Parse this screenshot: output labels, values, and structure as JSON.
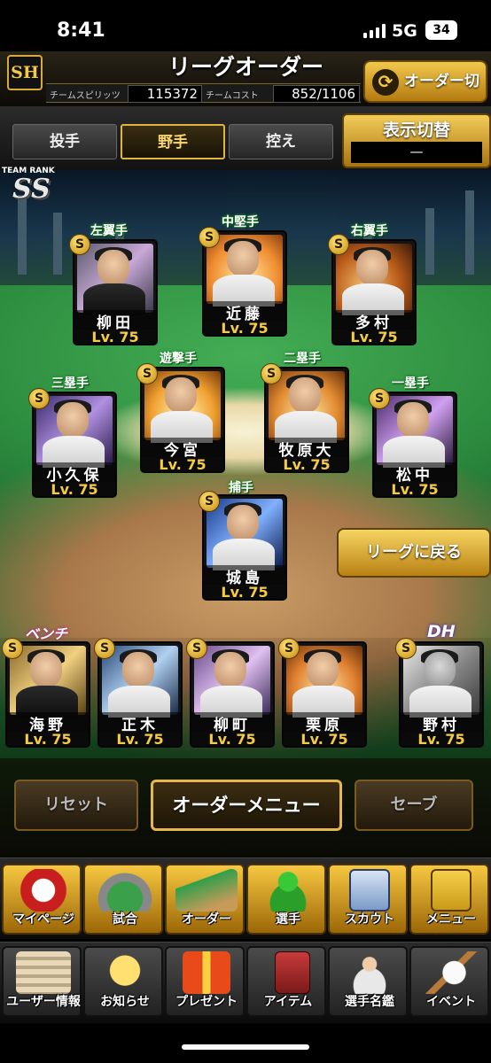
{
  "status": {
    "time": "8:41",
    "network": "5G",
    "battery": "34"
  },
  "header": {
    "logo": "SH",
    "title": "リーグオーダー",
    "spirit_label": "チームスピリッツ",
    "spirit_value": "115372",
    "cost_label": "チームコスト",
    "cost_value": "852/1106",
    "order_switch_label": "オーダー切替"
  },
  "tabs": [
    {
      "label": "投手",
      "active": false
    },
    {
      "label": "野手",
      "active": true
    },
    {
      "label": "控え",
      "active": false
    }
  ],
  "display_toggle": {
    "label": "表示切替",
    "value": "—"
  },
  "team_rank": {
    "label": "TEAM RANK",
    "value": "SS"
  },
  "positions": {
    "lf": {
      "label": "左翼手",
      "name": "柳田",
      "level": "Lv. 75"
    },
    "cf": {
      "label": "中堅手",
      "name": "近藤",
      "level": "Lv. 75"
    },
    "rf": {
      "label": "右翼手",
      "name": "多村",
      "level": "Lv. 75"
    },
    "ss": {
      "label": "遊撃手",
      "name": "今宮",
      "level": "Lv. 75"
    },
    "b2": {
      "label": "二塁手",
      "name": "牧原大",
      "level": "Lv. 75"
    },
    "b3": {
      "label": "三塁手",
      "name": "小久保",
      "level": "Lv. 75"
    },
    "b1": {
      "label": "一塁手",
      "name": "松中",
      "level": "Lv. 75"
    },
    "c": {
      "label": "捕手",
      "name": "城島",
      "level": "Lv. 75"
    }
  },
  "back_to_league": "リーグに戻る",
  "bench_label": "ベンチ",
  "bench": [
    {
      "name": "海野",
      "level": "Lv. 75"
    },
    {
      "name": "正木",
      "level": "Lv. 75"
    },
    {
      "name": "柳町",
      "level": "Lv. 75"
    },
    {
      "name": "栗原",
      "level": "Lv. 75"
    }
  ],
  "dh": {
    "label": "DH",
    "name": "野村",
    "level": "Lv. 75"
  },
  "badge_glyph": "S",
  "actions": {
    "reset": "リセット",
    "order_menu": "オーダーメニュー",
    "save": "セーブ"
  },
  "menu_row1": [
    {
      "label": "マイページ",
      "icon": "mypage-icon"
    },
    {
      "label": "試合",
      "icon": "stadium-icon"
    },
    {
      "label": "オーダー",
      "icon": "order-field-icon"
    },
    {
      "label": "選手",
      "icon": "player-icon"
    },
    {
      "label": "スカウト",
      "icon": "scout-card-icon"
    },
    {
      "label": "メニュー",
      "icon": "menu-box-icon"
    }
  ],
  "menu_row2": [
    {
      "label": "ユーザー情報",
      "icon": "user-info-icon"
    },
    {
      "label": "お知らせ",
      "icon": "notice-icon"
    },
    {
      "label": "プレゼント",
      "icon": "present-icon"
    },
    {
      "label": "アイテム",
      "icon": "item-icon"
    },
    {
      "label": "選手名鑑",
      "icon": "player-guide-icon"
    },
    {
      "label": "イベント",
      "icon": "event-icon"
    }
  ],
  "colors": {
    "gold": "#e5b74c",
    "level_text": "#f5cc44",
    "field_green": "#2d8d3f"
  }
}
